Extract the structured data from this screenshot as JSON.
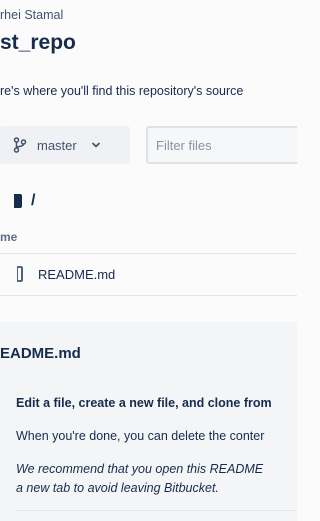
{
  "header": {
    "owner": "rhei Stamal",
    "repo_title": "st_repo",
    "description": "re's where you'll find this repository's source"
  },
  "toolbar": {
    "branch": {
      "label": "master",
      "icon": "branch-icon"
    },
    "filter": {
      "placeholder": "Filter files",
      "value": ""
    }
  },
  "breadcrumb": {
    "separator": "/"
  },
  "file_table": {
    "column_header": "me",
    "rows": [
      {
        "name": "README.md",
        "icon": "file-icon"
      }
    ]
  },
  "readme": {
    "title": "EADME.md",
    "heading": "Edit a file, create a new file, and clone from",
    "paragraph1": "When you're done, you can delete the conter",
    "paragraph2_line1": "We recommend that you open this README",
    "paragraph2_line2": "a new tab to avoid leaving Bitbucket."
  }
}
